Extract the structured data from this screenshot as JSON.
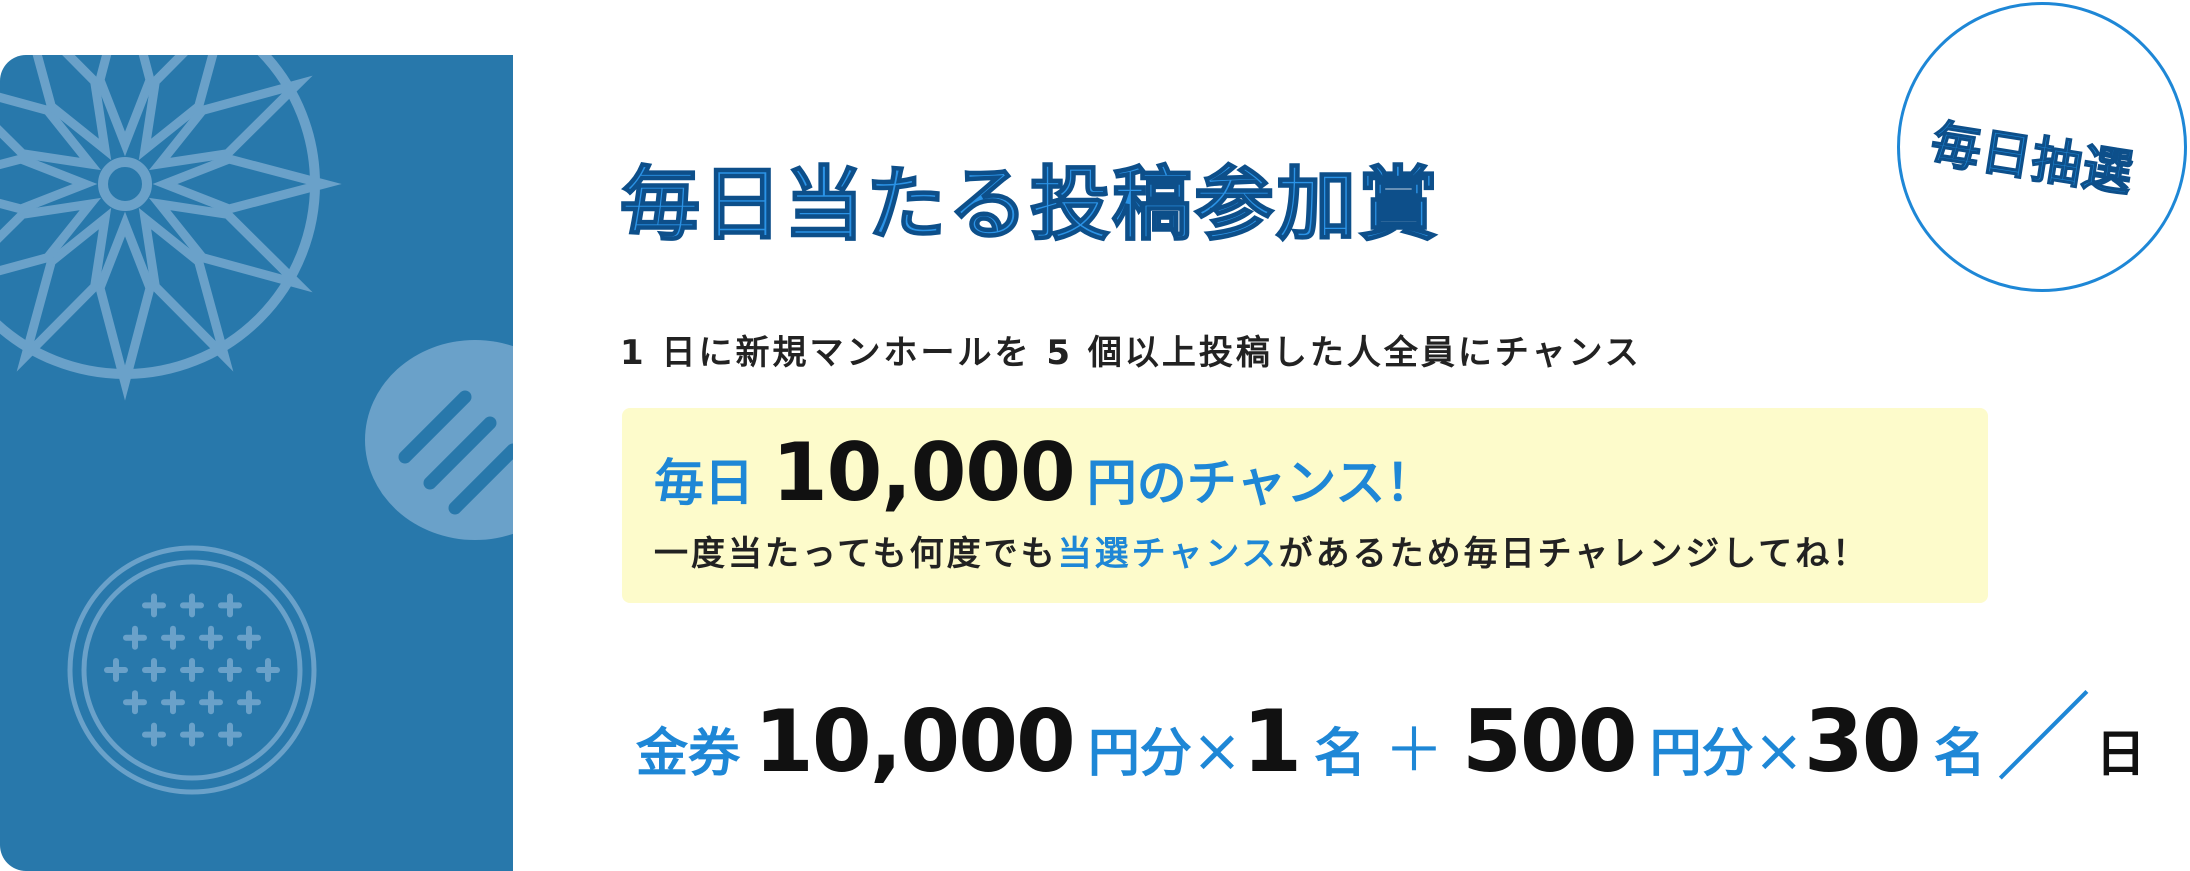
{
  "badge": {
    "text": "毎日抽選"
  },
  "heading": {
    "title": "毎日当たる投稿参加賞"
  },
  "description": {
    "text": "1 日に新規マンホールを 5 個以上投稿した人全員にチャンス"
  },
  "highlight": {
    "prefix": "毎日",
    "amount": "10,000",
    "suffix": "円のチャンス！",
    "note_before": "一度当たっても何度でも",
    "note_emphasis": "当選チャンス",
    "note_after": "があるため毎日チャレンジしてね！"
  },
  "prize": {
    "label": "金券",
    "amount1": "10,000",
    "unit1": "円分",
    "times1": "×",
    "count1": "1",
    "people1": "名",
    "plus": "＋",
    "amount2": "500",
    "unit2": "円分",
    "times2": "×",
    "count2": "30",
    "people2": "名",
    "slash": "／",
    "per": "日"
  },
  "colors": {
    "panel": "#2878ab",
    "accent": "#1e87d6",
    "highlight_bg": "#fdfbcb"
  }
}
